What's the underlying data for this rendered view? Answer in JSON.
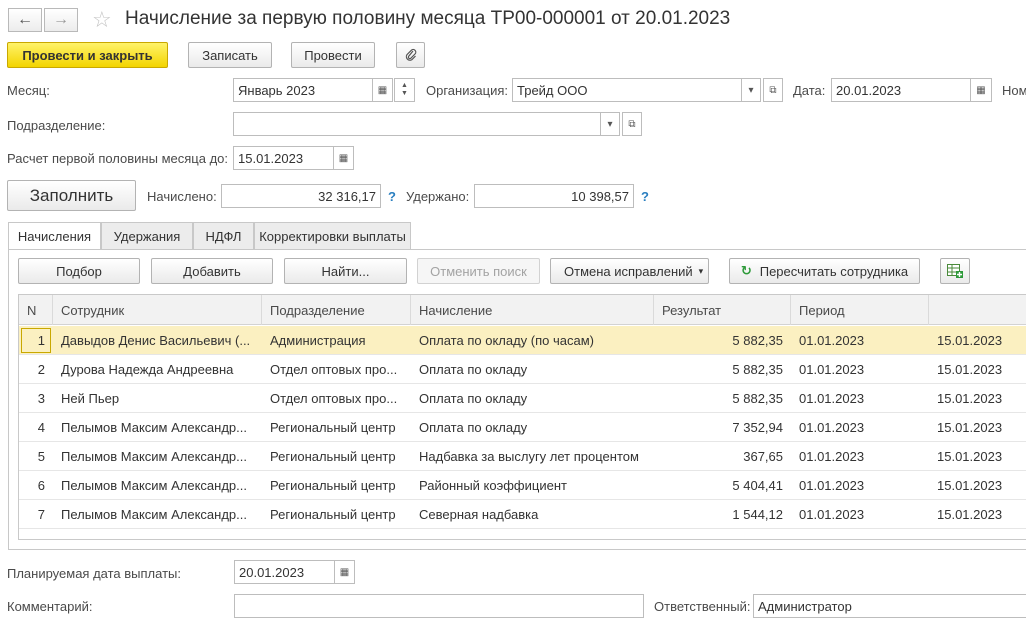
{
  "header": {
    "back_icon": "arrow-left-icon",
    "forward_icon": "arrow-right-icon",
    "star_icon": "star-outline-icon",
    "title": "Начисление за первую половину месяца ТР00-000001 от 20.01.2023"
  },
  "toolbar": {
    "post_close": "Провести и закрыть",
    "save": "Записать",
    "post": "Провести",
    "attach_icon": "paperclip-icon"
  },
  "form": {
    "month_label": "Месяц:",
    "month_value": "Январь 2023",
    "org_label": "Организация:",
    "org_value": "Трейд ООО",
    "date_label": "Дата:",
    "date_value": "20.01.2023",
    "number_label": "Ном",
    "dept_label": "Подразделение:",
    "dept_value": "",
    "calc_label": "Расчет первой половины месяца до:",
    "calc_value": "15.01.2023",
    "fill_button": "Заполнить",
    "accrued_label": "Начислено:",
    "accrued_value": "32 316,17",
    "withheld_label": "Удержано:",
    "withheld_value": "10 398,57",
    "help": "?"
  },
  "tabs": [
    "Начисления",
    "Удержания",
    "НДФЛ",
    "Корректировки выплаты"
  ],
  "grid_toolbar": {
    "pick": "Подбор",
    "add": "Добавить",
    "find": "Найти...",
    "cancel_search": "Отменить поиск",
    "cancel_corrections": "Отмена исправлений",
    "recalc": "Пересчитать сотрудника",
    "recalc_icon": "refresh-icon",
    "excel_icon": "spreadsheet-add-icon"
  },
  "table": {
    "columns": [
      "N",
      "Сотрудник",
      "Подразделение",
      "Начисление",
      "Результат",
      "Период",
      ""
    ],
    "rows": [
      {
        "n": "1",
        "employee": "Давыдов Денис Васильевич (...",
        "dept": "Администрация",
        "accrual": "Оплата по окладу (по часам)",
        "result": "5 882,35",
        "from": "01.01.2023",
        "to": "15.01.2023"
      },
      {
        "n": "2",
        "employee": "Дурова Надежда Андреевна",
        "dept": "Отдел оптовых про...",
        "accrual": "Оплата по окладу",
        "result": "5 882,35",
        "from": "01.01.2023",
        "to": "15.01.2023"
      },
      {
        "n": "3",
        "employee": "Ней Пьер",
        "dept": "Отдел оптовых про...",
        "accrual": "Оплата по окладу",
        "result": "5 882,35",
        "from": "01.01.2023",
        "to": "15.01.2023"
      },
      {
        "n": "4",
        "employee": "Пелымов Максим Александр...",
        "dept": "Региональный центр",
        "accrual": "Оплата по окладу",
        "result": "7 352,94",
        "from": "01.01.2023",
        "to": "15.01.2023"
      },
      {
        "n": "5",
        "employee": "Пелымов Максим Александр...",
        "dept": "Региональный центр",
        "accrual": "Надбавка за выслугу лет процентом",
        "result": "367,65",
        "from": "01.01.2023",
        "to": "15.01.2023"
      },
      {
        "n": "6",
        "employee": "Пелымов Максим Александр...",
        "dept": "Региональный центр",
        "accrual": "Районный коэффициент",
        "result": "5 404,41",
        "from": "01.01.2023",
        "to": "15.01.2023"
      },
      {
        "n": "7",
        "employee": "Пелымов Максим Александр...",
        "dept": "Региональный центр",
        "accrual": "Северная надбавка",
        "result": "1 544,12",
        "from": "01.01.2023",
        "to": "15.01.2023"
      }
    ]
  },
  "footer": {
    "paydate_label": "Планируемая дата выплаты:",
    "paydate_value": "20.01.2023",
    "comment_label": "Комментарий:",
    "comment_value": "",
    "responsible_label": "Ответственный:",
    "responsible_value": "Администратор"
  }
}
